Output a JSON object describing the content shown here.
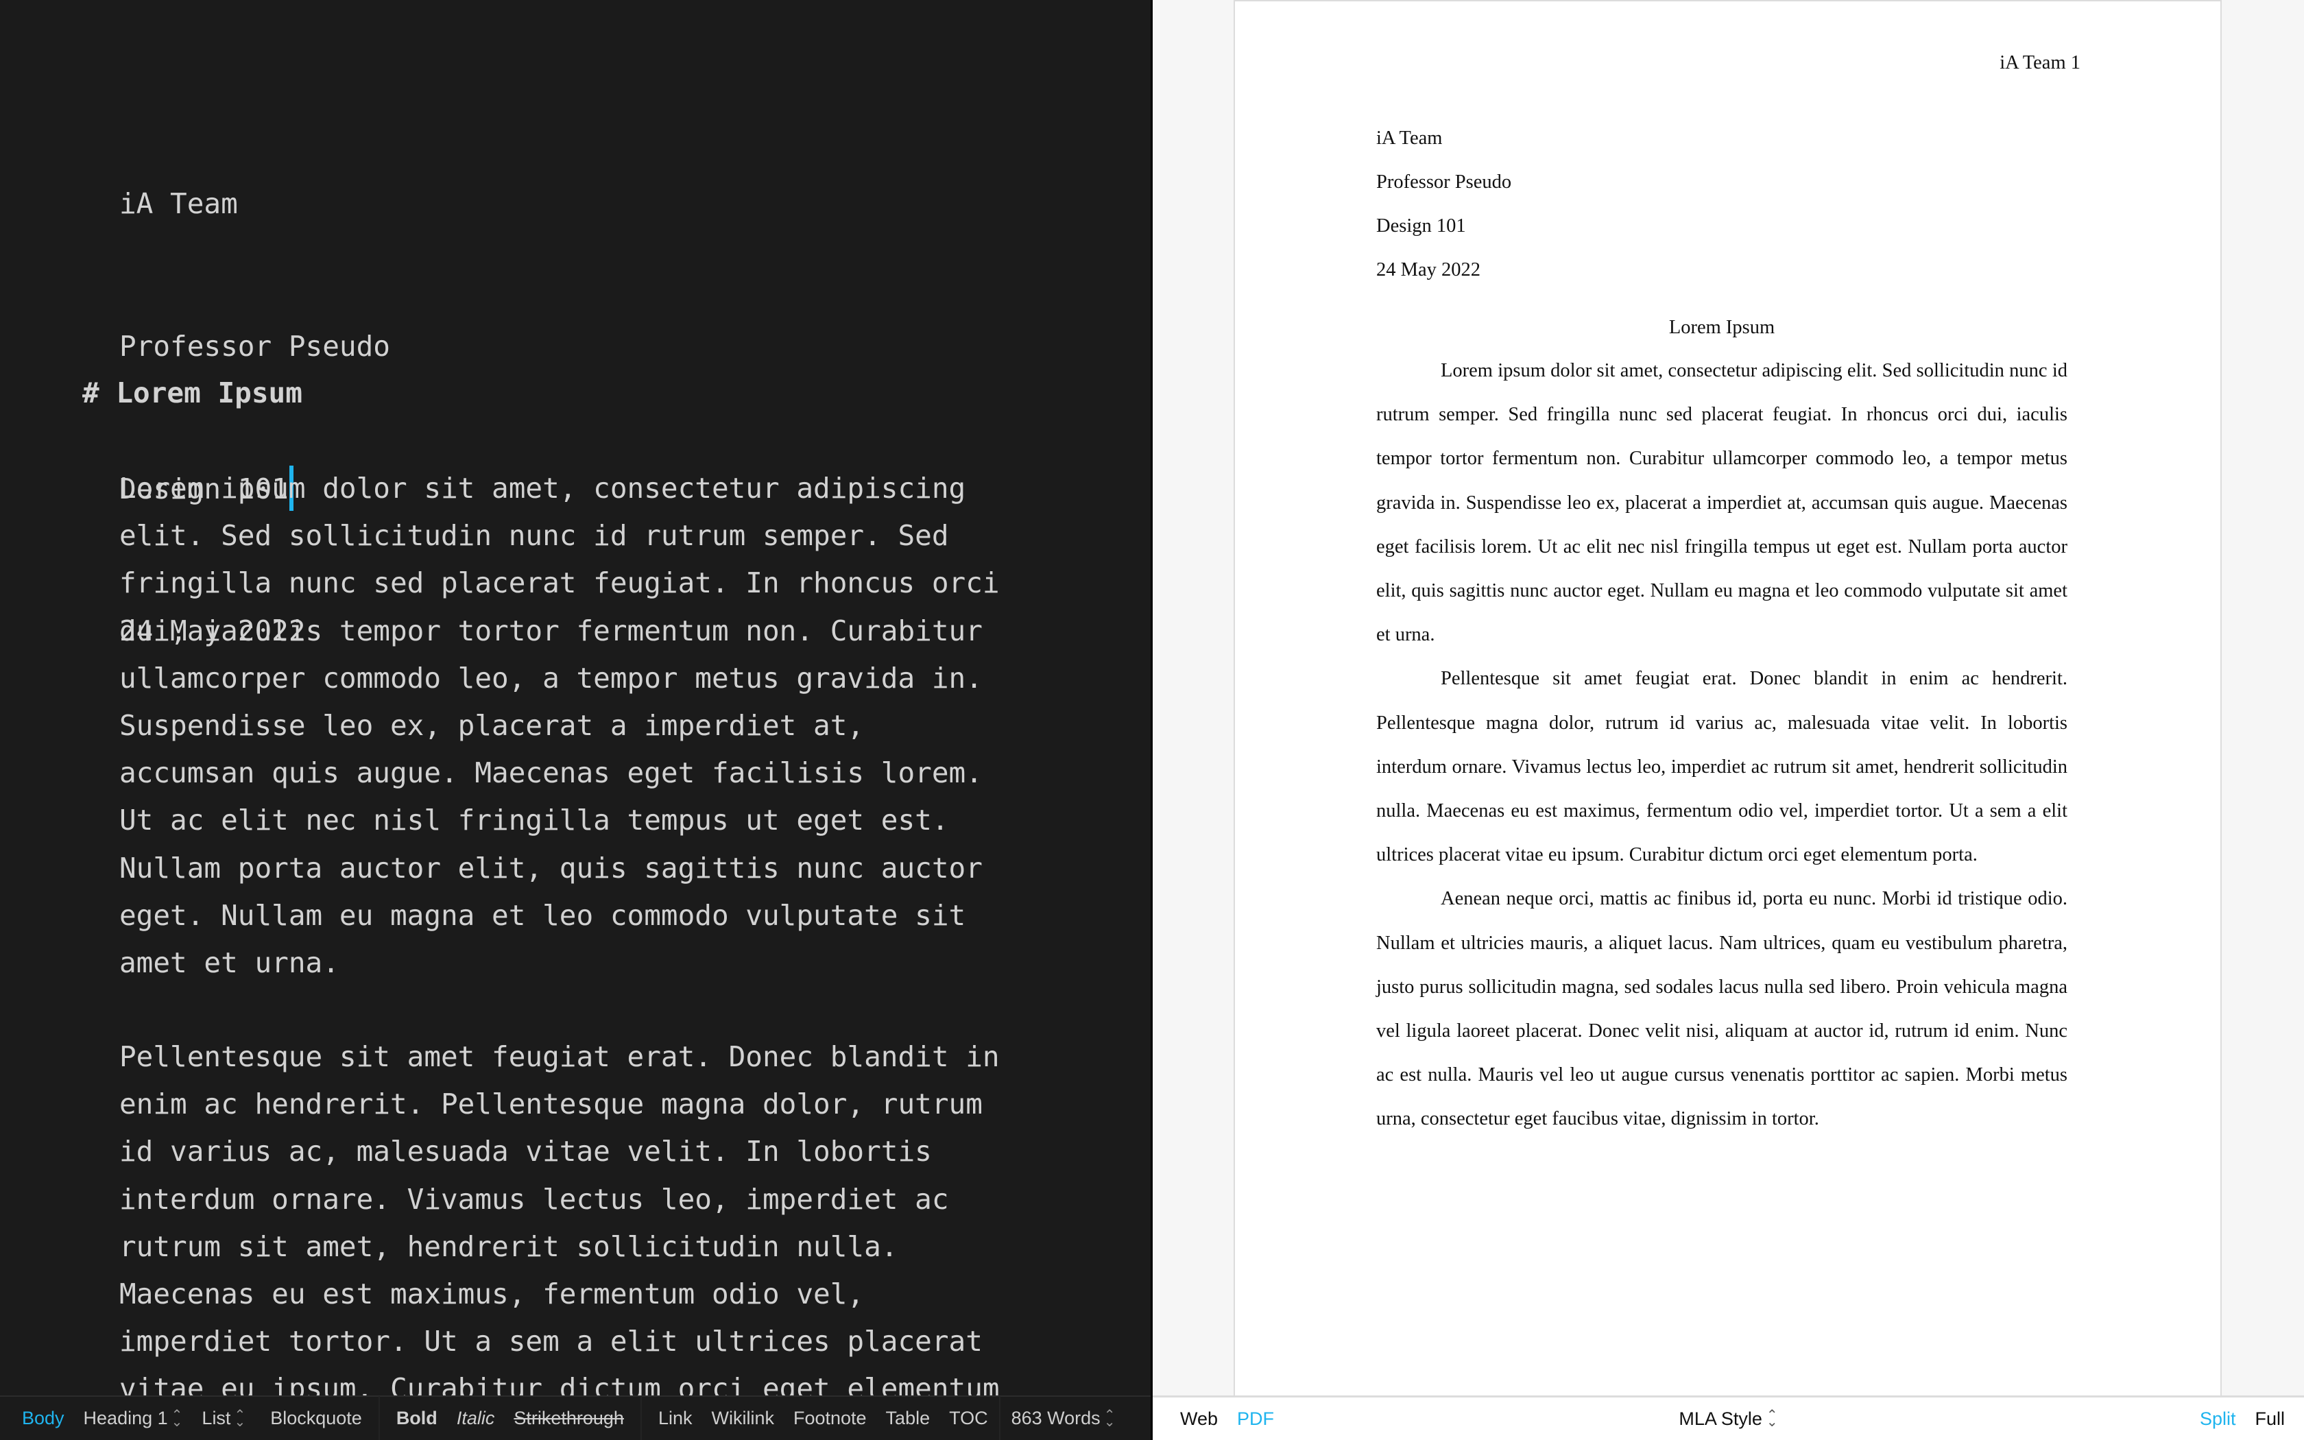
{
  "editor": {
    "meta_lines": [
      "iA Team",
      "Professor Pseudo",
      "Design 101",
      "24 May 2022"
    ],
    "cursor_line_index": 2,
    "heading_marker": "#",
    "heading_text": "Lorem Ipsum",
    "paragraph1_lines": [
      "Lorem ipsum dolor sit amet, consectetur adipiscing",
      "elit. Sed sollicitudin nunc id rutrum semper. Sed",
      "fringilla nunc sed placerat feugiat. In rhoncus orci",
      "dui, iaculis tempor tortor fermentum non. Curabitur",
      "ullamcorper commodo leo, a tempor metus gravida in.",
      "Suspendisse leo ex, placerat a imperdiet at,",
      "accumsan quis augue. Maecenas eget facilisis lorem.",
      "Ut ac elit nec nisl fringilla tempus ut eget est.",
      "Nullam porta auctor elit, quis sagittis nunc auctor",
      "eget. Nullam eu magna et leo commodo vulputate sit",
      "amet et urna."
    ],
    "paragraph2_lines": [
      "Pellentesque sit amet feugiat erat. Donec blandit in",
      "enim ac hendrerit. Pellentesque magna dolor, rutrum",
      "id varius ac, malesuada vitae velit. In lobortis",
      "interdum ornare. Vivamus lectus leo, imperdiet ac",
      "rutrum sit amet, hendrerit sollicitudin nulla.",
      "Maecenas eu est maximus, fermentum odio vel,",
      "imperdiet tortor. Ut a sem a elit ultrices placerat",
      "vitae eu ipsum. Curabitur dictum orci eget elementum"
    ]
  },
  "preview": {
    "running_header": "iA Team 1",
    "meta_lines": [
      "iA Team",
      "Professor Pseudo",
      "Design 101",
      "24 May 2022"
    ],
    "title": "Lorem Ipsum",
    "paragraphs": [
      "Lorem ipsum dolor sit amet, consectetur adipiscing elit. Sed sollicitudin nunc id rutrum semper. Sed fringilla nunc sed placerat feugiat. In rhoncus orci dui, iaculis tempor tortor fermentum non. Curabitur ullamcorper commodo leo, a tempor metus gravida in. Suspendisse leo ex, placerat a imperdiet at, accumsan quis augue. Maecenas eget facilisis lorem. Ut ac elit nec nisl fringilla tempus ut eget est. Nullam porta auctor elit, quis sagittis nunc auctor eget. Nullam eu magna et leo commodo vulputate sit amet et urna.",
      "Pellentesque sit amet feugiat erat. Donec blandit in enim ac hendrerit. Pellentesque magna dolor, rutrum id varius ac, malesuada vitae velit. In lobortis interdum ornare. Vivamus lectus leo, imperdiet ac rutrum sit amet, hendrerit sollicitudin nulla. Maecenas eu est maximus, fermentum odio vel, imperdiet tortor. Ut a sem a elit ultrices placerat vitae eu ipsum. Curabitur dictum orci eget elementum porta.",
      "Aenean neque orci, mattis ac finibus id, porta eu nunc. Morbi id tristique odio. Nullam et ultricies mauris, a aliquet lacus. Nam ultrices, quam eu vestibulum pharetra, justo purus sollicitudin magna, sed sodales lacus nulla sed libero. Proin vehicula magna vel ligula laoreet placerat. Donec velit nisi, aliquam at auctor id, rutrum id enim. Nunc ac est nulla. Mauris vel leo ut augue cursus venenatis porttitor ac sapien. Morbi metus urna, consectetur eget faucibus vitae, dignissim in tortor."
    ]
  },
  "toolbar": {
    "body": "Body",
    "heading": "Heading 1",
    "list": "List",
    "blockquote": "Blockquote",
    "bold": "Bold",
    "italic": "Italic",
    "strikethrough": "Strikethrough",
    "link": "Link",
    "wikilink": "Wikilink",
    "footnote": "Footnote",
    "table": "Table",
    "toc": "TOC",
    "word_count": "863 Words",
    "updown_glyph": "⌃⌄"
  },
  "preview_bar": {
    "web": "Web",
    "pdf": "PDF",
    "style": "MLA Style",
    "split": "Split",
    "full": "Full",
    "active_format": "PDF",
    "active_mode": "Split"
  },
  "colors": {
    "accent": "#1fb4ee",
    "editor_bg": "#1b1b1b",
    "editor_text": "#d2d2d2",
    "preview_bg": "#f6f6f6",
    "page_bg": "#ffffff"
  }
}
